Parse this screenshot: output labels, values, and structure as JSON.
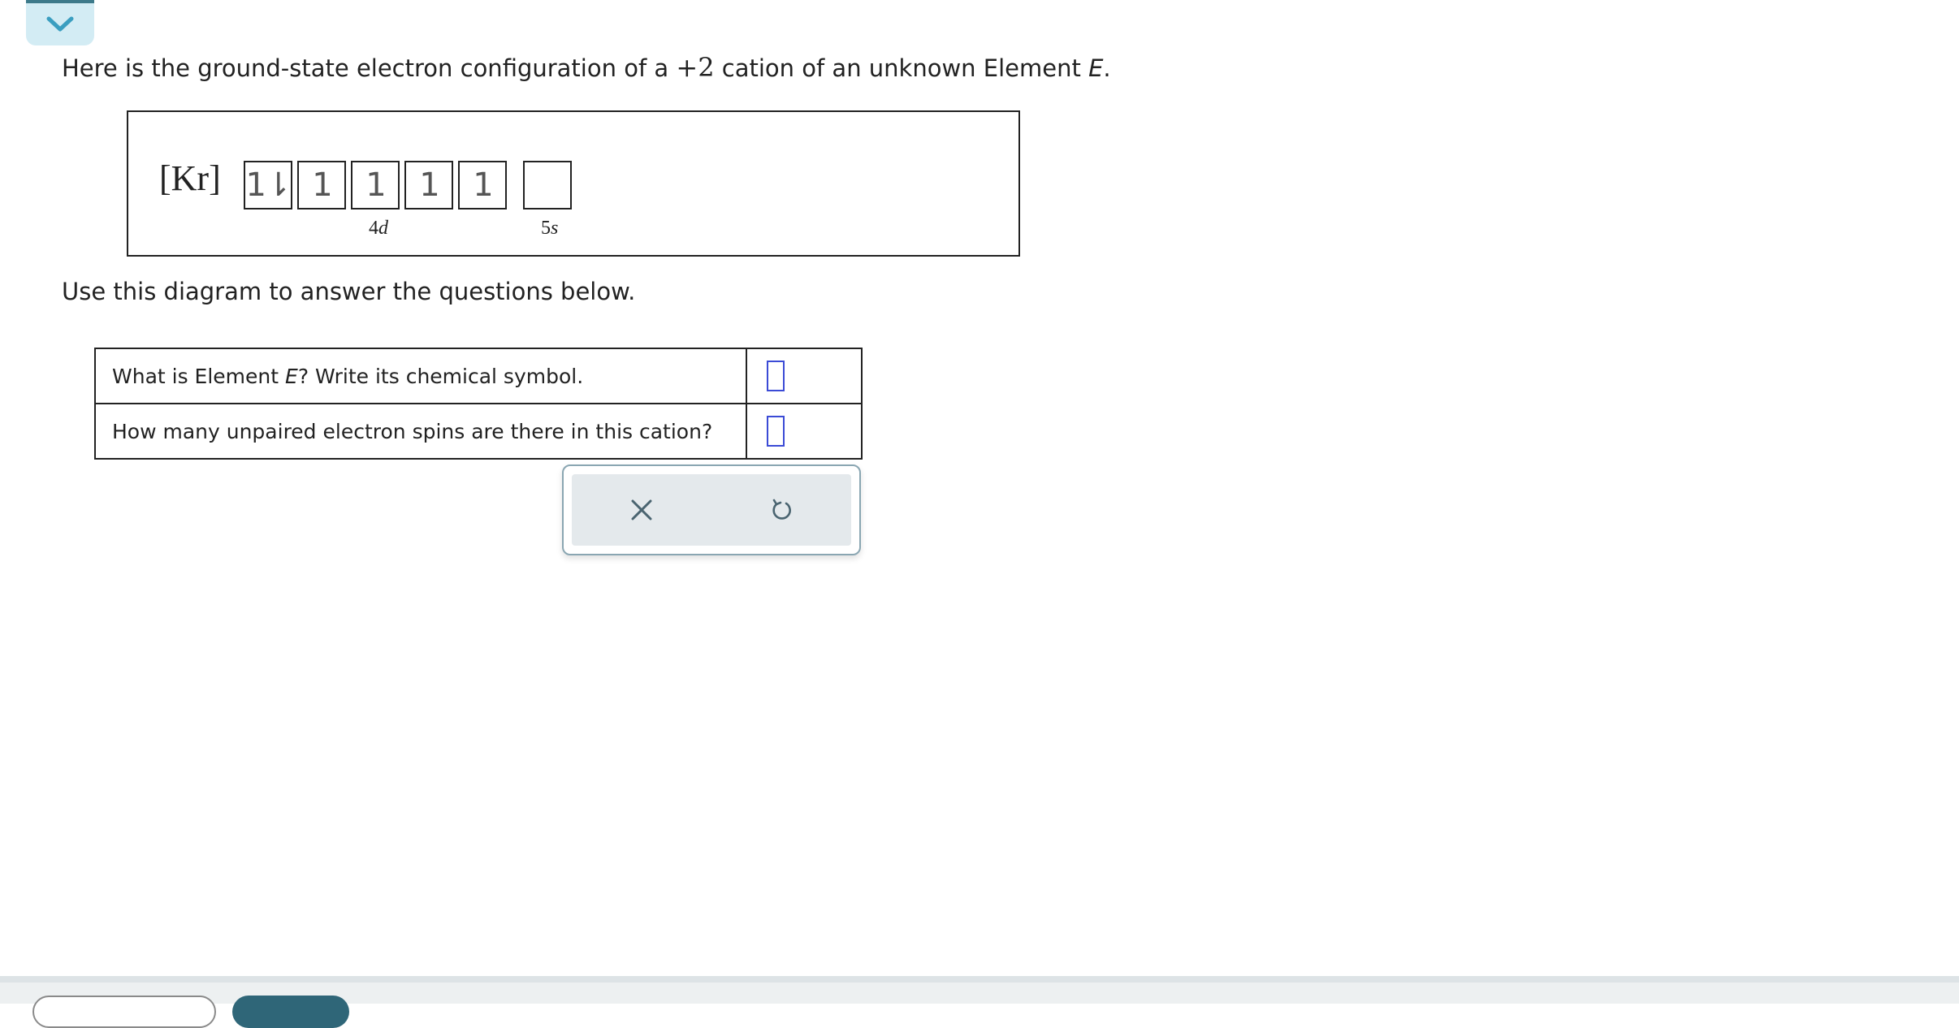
{
  "intro": {
    "before_charge": "Here is the ground-state electron configuration of a ",
    "charge": "+2",
    "after_charge": " cation of an unknown Element ",
    "element_var": "E",
    "end": "."
  },
  "diagram": {
    "core": "[Kr]",
    "subshells": [
      {
        "label_num": "4",
        "label_letter": "d",
        "boxes": [
          "1⇂",
          "1",
          "1",
          "1",
          "1"
        ]
      },
      {
        "label_num": "5",
        "label_letter": "s",
        "boxes": [
          ""
        ]
      }
    ]
  },
  "prompt": "Use this diagram to answer the questions below.",
  "questions": [
    {
      "before": "What is Element ",
      "var": "E",
      "after": "? Write its chemical symbol.",
      "answer": ""
    },
    {
      "before": "How many unpaired electron spins are there in this cation?",
      "var": "",
      "after": "",
      "answer": ""
    }
  ],
  "colors": {
    "tab_bg": "#d3ecf4",
    "accent": "#3d7a8a",
    "input_border": "#3b4bd6",
    "toolbar_bg": "#e4e9ec"
  },
  "icons": {
    "collapse": "chevron-down-icon",
    "clear": "close-icon",
    "undo": "undo-icon"
  }
}
